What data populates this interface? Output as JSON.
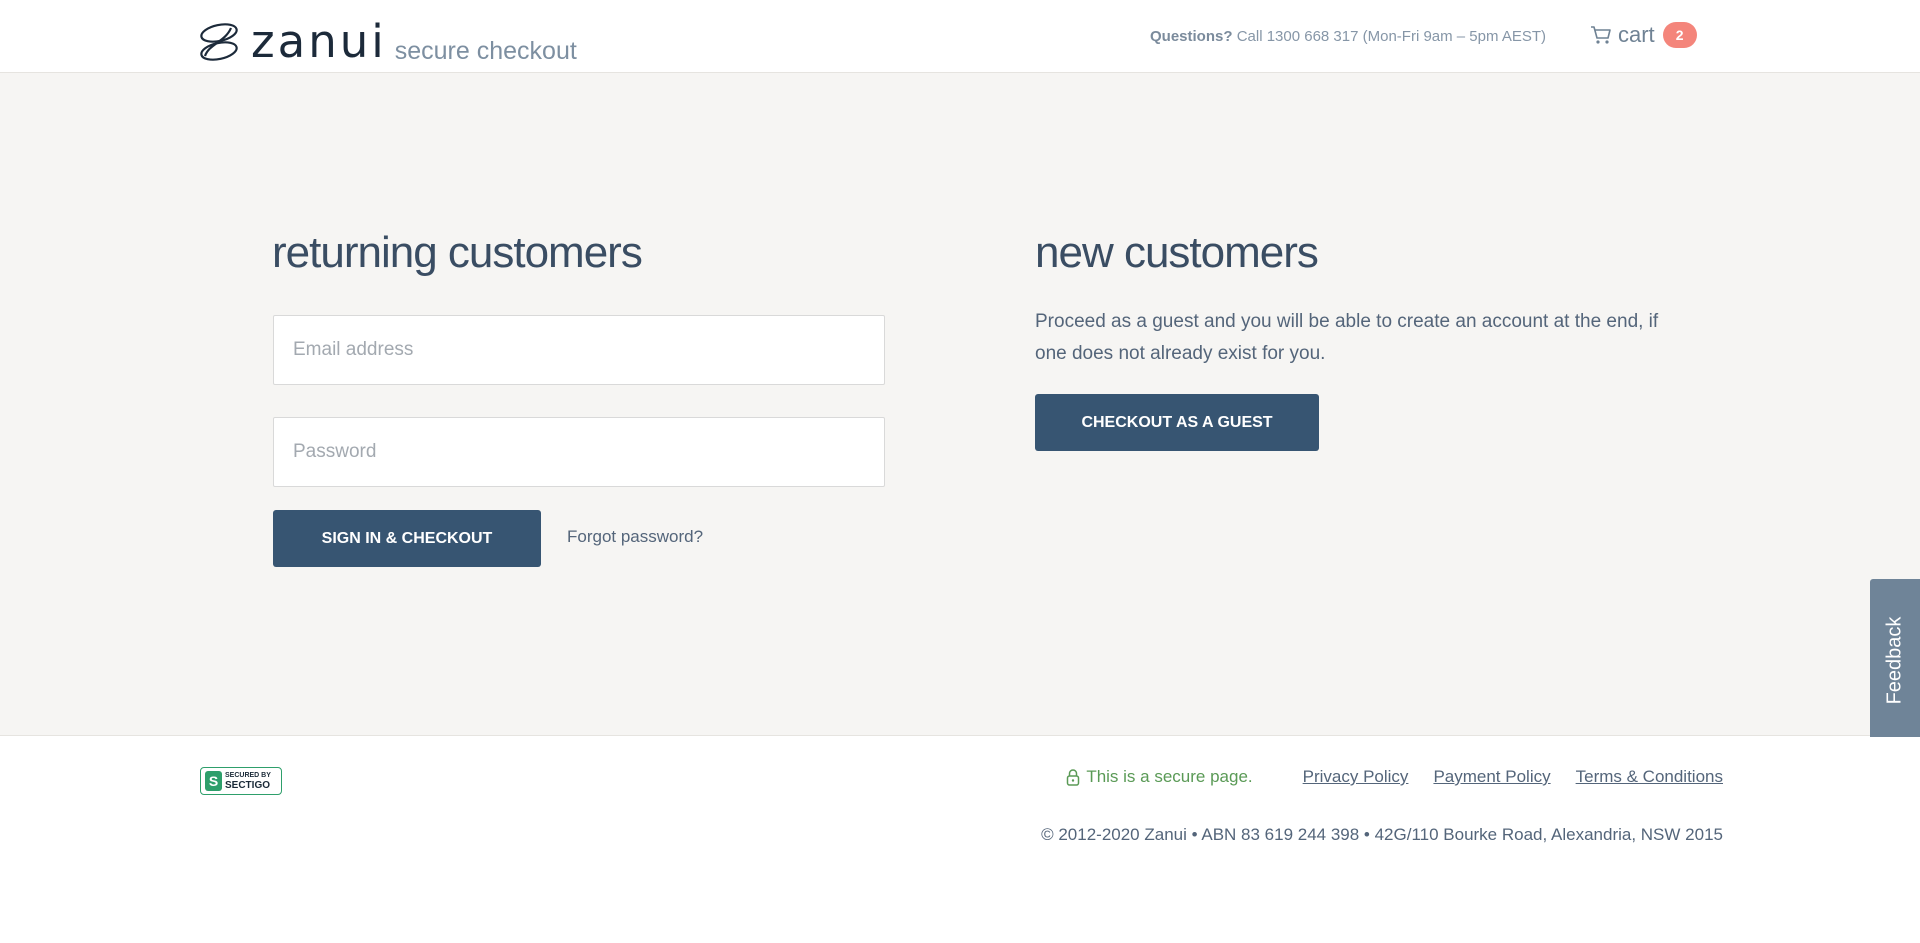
{
  "header": {
    "logo_text": "zanui",
    "logo_tagline": "secure checkout",
    "questions_label": "Questions?",
    "questions_text": "Call 1300 668 317 (Mon-Fri 9am – 5pm AEST)",
    "cart_label": "cart",
    "cart_count": "2",
    "cart_icon": "cart-icon"
  },
  "returning": {
    "heading": "returning customers",
    "email_placeholder": "Email address",
    "email_value": "",
    "password_placeholder": "Password",
    "password_value": "",
    "signin_label": "SIGN IN & CHECKOUT",
    "forgot_label": "Forgot password?"
  },
  "new_customers": {
    "heading": "new customers",
    "text": "Proceed as a guest and you will be able to create an account at the end, if one does not already exist for you.",
    "guest_label": "CHECKOUT AS A GUEST"
  },
  "feedback": {
    "label": "Feedback"
  },
  "footer": {
    "badge_top": "SECURED BY",
    "badge_bottom": "SECTIGO",
    "secure_text": "This is a secure page.",
    "links": [
      "Privacy Policy",
      "Payment Policy",
      "Terms & Conditions"
    ],
    "copyright": "© 2012-2020 Zanui • ABN 83 619 244 398 • 42G/110 Bourke Road, Alexandria, NSW 2015"
  },
  "colors": {
    "primary_button": "#375572",
    "cart_badge": "#f4857b",
    "secure_green": "#5a9a56",
    "page_background": "#f6f5f3"
  }
}
